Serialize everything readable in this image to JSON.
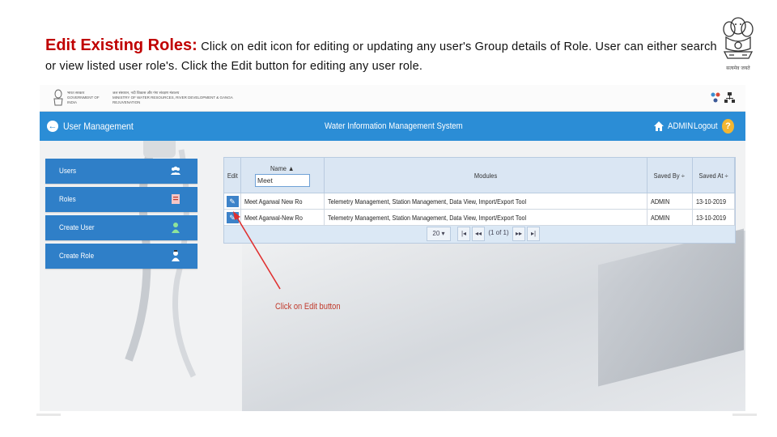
{
  "slide": {
    "heading_bold": "Edit Existing Roles:",
    "heading_text": "Click on edit icon  for editing or updating any user's Group details of Role. User can either search or view listed  user role's. Click the Edit button  for editing any user role.",
    "emblem_caption": "सत्यमेव जयते"
  },
  "govbar": {
    "line1": "भारत सरकार",
    "line1b": "GOVERNMENT OF INDIA",
    "line2": "जल संसाधन, नदी विकास और गंगा संरक्षण मंत्रालय",
    "line2b": "MINISTRY OF WATER RESOURCES, RIVER DEVELOPMENT & GANGA REJUVENATION"
  },
  "appbar": {
    "title": "User Management",
    "system": "Water Information Management System",
    "user": "ADMIN",
    "logout": "Logout",
    "help": "?"
  },
  "sidebar": {
    "items": [
      {
        "label": "Users",
        "icon": "users-icon"
      },
      {
        "label": "Roles",
        "icon": "roles-icon"
      },
      {
        "label": "Create User",
        "icon": "person-icon"
      },
      {
        "label": "Create Role",
        "icon": "create-role-icon"
      }
    ]
  },
  "grid": {
    "headers": {
      "edit": "Edit",
      "name": "Name ▲",
      "modules": "Modules",
      "saved_by": "Saved By ÷",
      "saved_at": "Saved At ÷"
    },
    "filter_value": "Meet",
    "rows": [
      {
        "name": "Meet Agarwal New Ro",
        "modules": "Telemetry Management, Station Management, Data View, Import/Export Tool",
        "saved_by": "ADMIN",
        "saved_at": "13-10-2019"
      },
      {
        "name": "Meet Agarwal-New Ro",
        "modules": "Telemetry Management, Station Management, Data View, Import/Export Tool",
        "saved_by": "ADMIN",
        "saved_at": "13-10-2019"
      }
    ],
    "pager": {
      "page_size": "20",
      "first": "|◂",
      "prev": "◂◂",
      "page_info": "(1 of 1)",
      "next": "▸▸",
      "last": "▸|"
    }
  },
  "annotation": "Click on Edit button",
  "colors": {
    "accent": "#2b8dd6",
    "sidebar": "#2f7fc8",
    "heading": "#c00000",
    "annotation": "#c0392b"
  }
}
